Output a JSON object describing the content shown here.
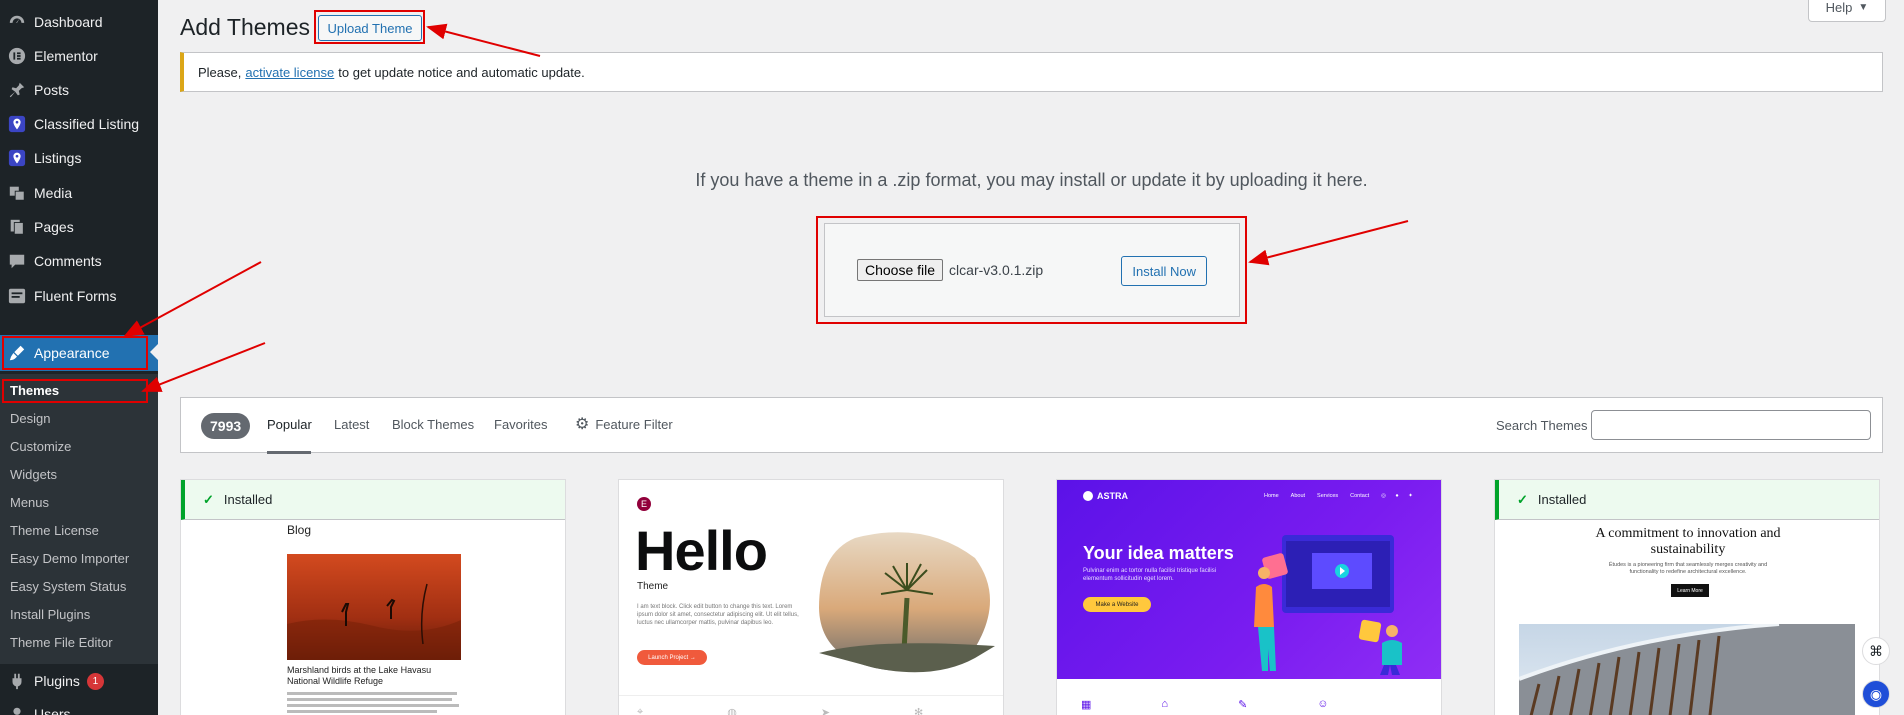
{
  "sidebar": {
    "items": [
      {
        "label": "Dashboard",
        "icon": "dashboard-icon"
      },
      {
        "label": "Elementor",
        "icon": "elementor-icon"
      },
      {
        "label": "Posts",
        "icon": "pin-icon"
      },
      {
        "label": "Classified Listing",
        "icon": "location-icon"
      },
      {
        "label": "Listings",
        "icon": "location-icon"
      },
      {
        "label": "Media",
        "icon": "media-icon"
      },
      {
        "label": "Pages",
        "icon": "pages-icon"
      },
      {
        "label": "Comments",
        "icon": "comment-icon"
      },
      {
        "label": "Fluent Forms",
        "icon": "forms-icon"
      },
      {
        "label": "Appearance",
        "icon": "brush-icon"
      }
    ],
    "submenu": [
      "Themes",
      "Design",
      "Customize",
      "Widgets",
      "Menus",
      "Theme License",
      "Easy Demo Importer",
      "Easy System Status",
      "Install Plugins",
      "Theme File Editor"
    ],
    "after": [
      {
        "label": "Plugins",
        "badge": "1"
      },
      {
        "label": "Users"
      }
    ]
  },
  "header": {
    "title": "Add Themes",
    "upload_label": "Upload Theme",
    "help_label": "Help"
  },
  "notice": {
    "prefix": "Please,",
    "link": "activate license",
    "suffix": "to get update notice and automatic update."
  },
  "upload": {
    "description": "If you have a theme in a .zip format, you may install or update it by uploading it here.",
    "choose_label": "Choose file",
    "file_name": "clcar-v3.0.1.zip",
    "install_label": "Install Now"
  },
  "filters": {
    "count": "7993",
    "tabs": [
      "Popular",
      "Latest",
      "Block Themes",
      "Favorites"
    ],
    "feature_filter": "Feature Filter",
    "search_label": "Search Themes"
  },
  "cards": {
    "installed_label": "Installed",
    "card1": {
      "heading": "Blog",
      "caption": "Marshland birds at the Lake Havasu National Wildlife Refuge"
    },
    "card2": {
      "title": "Hello",
      "subtitle": "Theme",
      "body": "I am text block. Click edit button to change this text. Lorem ipsum dolor sit amet, consectetur adipiscing elit. Ut elit tellus, luctus nec ullamcorper mattis, pulvinar dapibus leo.",
      "cta": "Launch Project →"
    },
    "card3": {
      "brand": "ASTRA",
      "nav": [
        "Home",
        "About",
        "Services",
        "Contact"
      ],
      "headline": "Your idea matters",
      "body": "Pulvinar enim ac tortor nulla facilisi tristique facilisi elementum sollicitudin eget lorem.",
      "cta": "Make a Website"
    },
    "card4": {
      "headline": "A commitment to innovation and sustainability",
      "body": "Études is a pioneering firm that seamlessly merges creativity and functionality to redefine architectural excellence.",
      "cta": "Learn More"
    }
  },
  "colors": {
    "sidebar_bg": "#1d2327",
    "accent": "#2271b1",
    "notice_border": "#dba617",
    "installed_green": "#00a32a",
    "annotation_red": "#e00000"
  }
}
